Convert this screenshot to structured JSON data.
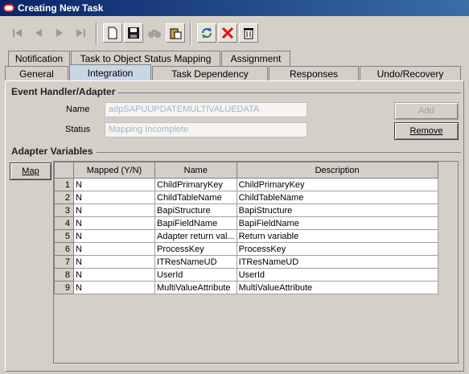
{
  "window": {
    "title": "Creating New Task"
  },
  "toolbar": {
    "icons": [
      "first-icon",
      "previous-icon",
      "next-icon",
      "last-icon",
      "new-icon",
      "save-icon",
      "find-icon",
      "paste-icon",
      "refresh-icon",
      "delete-icon",
      "trash-icon"
    ]
  },
  "tabs_row1": [
    "Notification",
    "Task to Object Status Mapping",
    "Assignment"
  ],
  "tabs_row2": [
    "General",
    "Integration",
    "Task Dependency",
    "Responses",
    "Undo/Recovery"
  ],
  "selected_tab": "Integration",
  "event_handler": {
    "title": "Event Handler/Adapter",
    "name_label": "Name",
    "name_value": "adpSAPUUPDATEMULTIVALUEDATA",
    "status_label": "Status",
    "status_value": "Mapping Incomplete",
    "add_label": "Add",
    "remove_label": "Remove"
  },
  "adapter_variables": {
    "title": "Adapter Variables",
    "map_label": "Map",
    "columns": [
      "Mapped (Y/N)",
      "Name",
      "Description"
    ],
    "rows": [
      {
        "n": "1",
        "mapped": "N",
        "name": "ChildPrimaryKey",
        "desc": "ChildPrimaryKey"
      },
      {
        "n": "2",
        "mapped": "N",
        "name": "ChildTableName",
        "desc": "ChildTableName"
      },
      {
        "n": "3",
        "mapped": "N",
        "name": "BapiStructure",
        "desc": "BapiStructure"
      },
      {
        "n": "4",
        "mapped": "N",
        "name": "BapiFieldName",
        "desc": "BapiFieldName"
      },
      {
        "n": "5",
        "mapped": "N",
        "name": "Adapter return val...",
        "desc": "Return variable"
      },
      {
        "n": "6",
        "mapped": "N",
        "name": "ProcessKey",
        "desc": "ProcessKey"
      },
      {
        "n": "7",
        "mapped": "N",
        "name": "ITResNameUD",
        "desc": "ITResNameUD"
      },
      {
        "n": "8",
        "mapped": "N",
        "name": "UserId",
        "desc": "UserId"
      },
      {
        "n": "9",
        "mapped": "N",
        "name": "MultiValueAttribute",
        "desc": "MultiValueAttribute"
      }
    ]
  }
}
